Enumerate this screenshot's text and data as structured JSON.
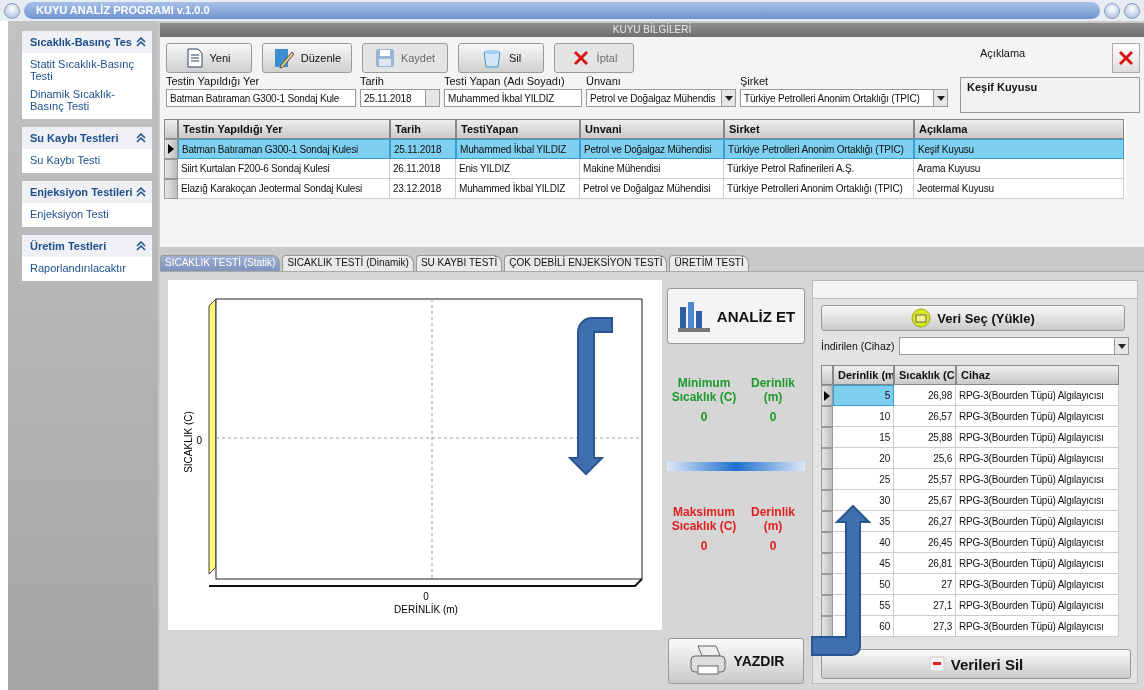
{
  "window": {
    "title": "KUYU ANALİZ PROGRAMI v.1.0.0"
  },
  "sidebar": {
    "groups": [
      {
        "title": "Sıcaklık-Basınç Tes",
        "expanded": true,
        "items": [
          "Statit Sıcaklık-Basınç Testi",
          "Dinamik Sıcaklık-Basınç Testi"
        ]
      },
      {
        "title": "Su Kaybı Testleri",
        "expanded": true,
        "items": [
          "Su Kaybı Testi"
        ]
      },
      {
        "title": "Enjeksiyon Testileri",
        "expanded": true,
        "items": [
          "Enjeksiyon Testi"
        ]
      },
      {
        "title": "Üretim Testleri",
        "expanded": true,
        "items": [
          "Raporlandırılacaktır"
        ]
      }
    ]
  },
  "panel": {
    "title": "KUYU BİLGİLERİ",
    "toolbar": [
      {
        "kind": "new",
        "label": "Yeni",
        "disabled": false
      },
      {
        "kind": "edit",
        "label": "Düzenle",
        "disabled": false
      },
      {
        "kind": "save",
        "label": "Kaydet",
        "disabled": true
      },
      {
        "kind": "delete",
        "label": "Sil",
        "disabled": false
      },
      {
        "kind": "cancel",
        "label": "İptal",
        "disabled": true
      }
    ],
    "fields": [
      {
        "kind": "text",
        "label": "Testin Yapıldığı Yer",
        "value": "Batman Batıraman G300-1 Sondaj Kule"
      },
      {
        "kind": "date",
        "label": "Tarih",
        "value": "25.11.2018"
      },
      {
        "kind": "text",
        "label": "Testi Yapan (Adı Soyadı)",
        "value": "Muhammed İkbal YILDIZ"
      },
      {
        "kind": "combo",
        "label": "Ünvanı",
        "value": "Petrol ve Doğalgaz Mühendis"
      },
      {
        "kind": "combo",
        "label": "Şirket",
        "value": "Türkiye Petrolleri Anonim Ortaklığı (TPIC)"
      }
    ],
    "description": {
      "label": "Açıklama",
      "value": "Keşif Kuyusu"
    },
    "table": {
      "columns": [
        "Testin Yapıldığı Yer",
        "Tarih",
        "TestiYapan",
        "Unvani",
        "Sirket",
        "Açıklama"
      ],
      "rows": [
        {
          "selected": true,
          "cells": [
            "Batman Batıraman G300-1 Sondaj Kulesi",
            "25.11.2018",
            "Muhammed İkbal YILDIZ",
            "Petrol ve Doğalgaz Mühendisi",
            "Türkiye Petrolleri Anonim Ortaklığı (TPIC)",
            "Keşif Kuyusu"
          ]
        },
        {
          "selected": false,
          "cells": [
            "Siirt Kurtalan F200-6 Sondaj Kulesi",
            "26.11.2018",
            "Enis YILDIZ",
            "Makine Mühendisi",
            "Türkiye Petrol Rafinerileri A.Ş.",
            "Arama Kuyusu"
          ]
        },
        {
          "selected": false,
          "cells": [
            "Elazığ Karakoçan Jeotermal Sondaj Kulesi",
            "23.12.2018",
            "Muhammed İkbal YILDIZ",
            "Petrol ve Doğalgaz Mühendisi",
            "Türkiye Petrolleri Anonim Ortaklığı (TPIC)",
            "Jeotermal Kuyusu"
          ]
        }
      ]
    }
  },
  "tabs": [
    {
      "label": "SICAKLIK TESTİ (Statik)",
      "selected": true
    },
    {
      "label": "SICAKLIK TESTİ (Dinamik)",
      "selected": false
    },
    {
      "label": "SU KAYBI TESTİ",
      "selected": false
    },
    {
      "label": "ÇOK DEBİLİ ENJEKSİYON TESTİ",
      "selected": false
    },
    {
      "label": "ÜRETİM TESTİ",
      "selected": false
    }
  ],
  "chart": {
    "xlabel": "DERİNLİK (m)",
    "ylabel": "SICAKLIK (C)",
    "xtick": "0",
    "ytick": "0"
  },
  "analyze_button": "ANALİZ ET",
  "stats": [
    {
      "kind": "min",
      "label": "Minimum Sıcaklık (C)",
      "value": "0",
      "depth_label": "Derinlik (m)",
      "depth_value": "0"
    },
    {
      "kind": "max",
      "label": "Maksimum Sıcaklık (C)",
      "value": "0",
      "depth_label": "Derinlik (m)",
      "depth_value": "0"
    }
  ],
  "print_button": "YAZDIR",
  "data": {
    "load_button": "Veri Seç (Yükle)",
    "device_label": "İndirilen (Cihaz)",
    "columns": [
      "Derinlik (m",
      "Sıcaklık (C",
      "Cihaz"
    ],
    "rows": [
      {
        "selected": true,
        "cells": [
          "5",
          "26,98",
          "RPG-3(Bourden Tüpü) Algılayıcısı"
        ]
      },
      {
        "selected": false,
        "cells": [
          "10",
          "26,57",
          "RPG-3(Bourden Tüpü) Algılayıcısı"
        ]
      },
      {
        "selected": false,
        "cells": [
          "15",
          "25,88",
          "RPG-3(Bourden Tüpü) Algılayıcısı"
        ]
      },
      {
        "selected": false,
        "cells": [
          "20",
          "25,6",
          "RPG-3(Bourden Tüpü) Algılayıcısı"
        ]
      },
      {
        "selected": false,
        "cells": [
          "25",
          "25,57",
          "RPG-3(Bourden Tüpü) Algılayıcısı"
        ]
      },
      {
        "selected": false,
        "cells": [
          "30",
          "25,67",
          "RPG-3(Bourden Tüpü) Algılayıcısı"
        ]
      },
      {
        "selected": false,
        "cells": [
          "35",
          "26,27",
          "RPG-3(Bourden Tüpü) Algılayıcısı"
        ]
      },
      {
        "selected": false,
        "cells": [
          "40",
          "26,45",
          "RPG-3(Bourden Tüpü) Algılayıcısı"
        ]
      },
      {
        "selected": false,
        "cells": [
          "45",
          "26,81",
          "RPG-3(Bourden Tüpü) Algılayıcısı"
        ]
      },
      {
        "selected": false,
        "cells": [
          "50",
          "27",
          "RPG-3(Bourden Tüpü) Algılayıcısı"
        ]
      },
      {
        "selected": false,
        "cells": [
          "55",
          "27,1",
          "RPG-3(Bourden Tüpü) Algılayıcısı"
        ]
      },
      {
        "selected": false,
        "cells": [
          "60",
          "27,3",
          "RPG-3(Bourden Tüpü) Algılayıcısı"
        ]
      }
    ],
    "clear_button": "Verileri Sil"
  }
}
